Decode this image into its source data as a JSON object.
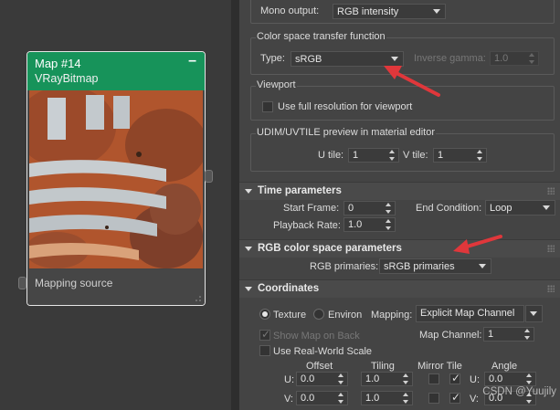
{
  "node": {
    "title": "Map #14",
    "subtitle": "VRayBitmap",
    "footer": "Mapping source",
    "minimize_icon": "minus-icon",
    "header_color": "#17935a"
  },
  "mono_output": {
    "label": "Mono output:",
    "value": "RGB intensity"
  },
  "color_space": {
    "group_label": "Color space transfer function",
    "type_label": "Type:",
    "type_value": "sRGB",
    "inverse_gamma_label": "Inverse gamma:",
    "inverse_gamma_value": "1.0"
  },
  "viewport": {
    "group_label": "Viewport",
    "full_res_label": "Use full resolution for viewport"
  },
  "udim": {
    "group_label": "UDIM/UVTILE preview in material editor",
    "u_tile_label": "U tile:",
    "u_tile_value": "1",
    "v_tile_label": "V tile:",
    "v_tile_value": "1"
  },
  "time_params": {
    "title": "Time parameters",
    "start_frame_label": "Start Frame:",
    "start_frame_value": "0",
    "end_condition_label": "End Condition:",
    "end_condition_value": "Loop",
    "playback_rate_label": "Playback Rate:",
    "playback_rate_value": "1.0"
  },
  "rgb_params": {
    "title": "RGB color space parameters",
    "primaries_label": "RGB primaries:",
    "primaries_value": "sRGB primaries"
  },
  "coordinates": {
    "title": "Coordinates",
    "texture_label": "Texture",
    "environ_label": "Environ",
    "mapping_label": "Mapping:",
    "mapping_value": "Explicit Map Channel",
    "show_map_label": "Show Map on Back",
    "map_channel_label": "Map Channel:",
    "map_channel_value": "1",
    "real_world_label": "Use Real-World Scale",
    "col_offset": "Offset",
    "col_tiling": "Tiling",
    "col_mirror_tile": "Mirror Tile",
    "col_angle": "Angle",
    "row_u_label": "U:",
    "row_v_label": "V:",
    "u_offset": "0.0",
    "u_tiling": "1.0",
    "u_angle_label": "U:",
    "u_angle": "0.0",
    "v_offset": "0.0",
    "v_tiling": "1.0",
    "v_angle_label": "V:",
    "v_angle": "0.0"
  },
  "watermark": "CSDN @Yuujily",
  "annotation_color": "#e0373b"
}
